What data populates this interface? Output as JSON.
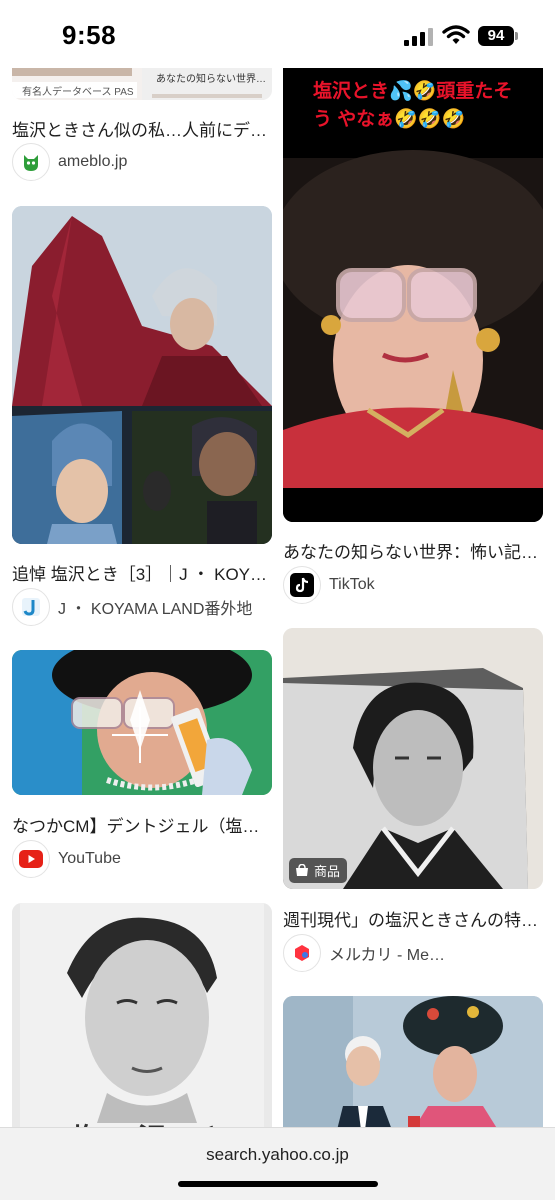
{
  "status_bar": {
    "time": "9:58",
    "battery": "94"
  },
  "results": {
    "left": [
      {
        "thumb_labels": [
          "有名人データベース PAS",
          "あなたの知らない世界…"
        ],
        "caption": "塩沢ときさん似の私…人前にデ…",
        "source": "ameblo.jp"
      },
      {
        "caption": "追悼 塩沢とき［3］｜J ・ KOY…",
        "source": "J ・ KOYAMA LAND番外地"
      },
      {
        "caption": "なつかCM】デントジェル（塩…",
        "source": "YouTube"
      },
      {
        "caption_partial": "塩 沢 と"
      }
    ],
    "right": [
      {
        "overlay": "塩沢とき💦🤣頭重たそう やなぁ🤣🤣🤣",
        "caption": "あなたの知らない世界：怖い記…",
        "source": "TikTok"
      },
      {
        "badge": "商品",
        "caption": "週刊現代」の塩沢ときさんの特…",
        "source": "メルカリ - Me…"
      },
      {}
    ]
  },
  "url_bar": {
    "url": "search.yahoo.co.jp"
  },
  "colors": {
    "tiktok": "#000000",
    "youtube": "#e62117",
    "mercari": "#ff333f",
    "ameblo": "#2e9e3a",
    "jkoyama": "#1e88c8"
  }
}
